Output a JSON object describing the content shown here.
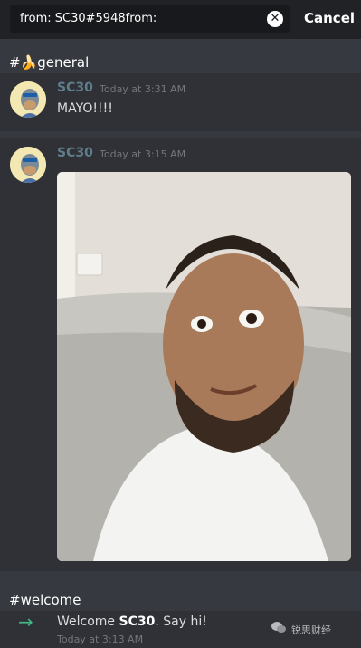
{
  "search": {
    "query": "from: SC30#5948from:",
    "cancel_label": "Cancel"
  },
  "results": [
    {
      "channel": "#🍌general",
      "author": "SC30",
      "timestamp": "Today at 3:31 AM",
      "text": "MAYO!!!!"
    },
    {
      "author": "SC30",
      "timestamp": "Today at 3:15 AM",
      "attachment": "selfie photo"
    },
    {
      "channel": "#welcome",
      "welcome_prefix": "Welcome ",
      "welcome_name": "SC30",
      "welcome_suffix": ". Say hi!",
      "timestamp": "Today at 3:13 AM"
    }
  ],
  "watermark": "锐思财经",
  "colors": {
    "background": "#36393f",
    "card": "#2f3136",
    "author": "#607d8b",
    "join_arrow": "#43b581"
  }
}
